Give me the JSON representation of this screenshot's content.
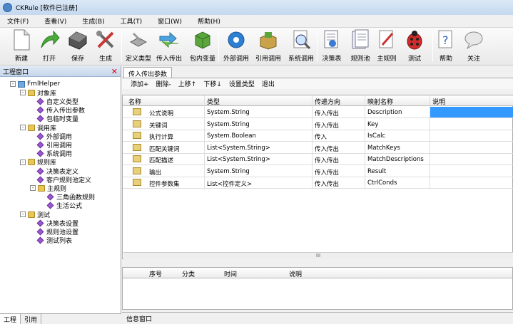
{
  "window": {
    "title": "CKRule [软件已注册]"
  },
  "menu": [
    "文件(F)",
    "查看(V)",
    "生成(B)",
    "工具(T)",
    "窗口(W)",
    "帮助(H)"
  ],
  "toolbar": {
    "new": "新建",
    "open": "打开",
    "save": "保存",
    "build": "生成",
    "define_type": "定义类型",
    "io": "传入传出",
    "pkg_var": "包内变量",
    "ext_call": "外部调用",
    "ref_call": "引用调用",
    "sys_call": "系统调用",
    "decision_table": "决策表",
    "rule_pool": "规则池",
    "main_rule": "主规则",
    "test": "测试",
    "help": "帮助",
    "about": "关注"
  },
  "left": {
    "title": "工程窗口",
    "tree": [
      {
        "label": "FmlHelper",
        "level": 0,
        "kind": "root",
        "toggle": "-"
      },
      {
        "label": "对象库",
        "level": 1,
        "kind": "folder",
        "toggle": "-"
      },
      {
        "label": "自定义类型",
        "level": 2,
        "kind": "item"
      },
      {
        "label": "传入传出参数",
        "level": 2,
        "kind": "item"
      },
      {
        "label": "包临时变量",
        "level": 2,
        "kind": "item"
      },
      {
        "label": "调用库",
        "level": 1,
        "kind": "folder",
        "toggle": "-"
      },
      {
        "label": "外部调用",
        "level": 2,
        "kind": "item"
      },
      {
        "label": "引用调用",
        "level": 2,
        "kind": "item"
      },
      {
        "label": "系统调用",
        "level": 2,
        "kind": "item"
      },
      {
        "label": "规则库",
        "level": 1,
        "kind": "folder",
        "toggle": "-"
      },
      {
        "label": "决策表定义",
        "level": 2,
        "kind": "item"
      },
      {
        "label": "客户规则池定义",
        "level": 2,
        "kind": "item"
      },
      {
        "label": "主规则",
        "level": 2,
        "kind": "folder",
        "toggle": "-"
      },
      {
        "label": "三角函数规则",
        "level": 3,
        "kind": "item"
      },
      {
        "label": "生活公式",
        "level": 3,
        "kind": "item"
      },
      {
        "label": "测试",
        "level": 1,
        "kind": "folder",
        "toggle": "-"
      },
      {
        "label": "决策表设置",
        "level": 2,
        "kind": "item"
      },
      {
        "label": "规则池设置",
        "level": 2,
        "kind": "item"
      },
      {
        "label": "测试列表",
        "level": 2,
        "kind": "item"
      }
    ],
    "tabs": [
      "工程",
      "引用"
    ]
  },
  "main": {
    "doc_tab": "传入传出参数",
    "actions": [
      "添加+",
      "删除-",
      "上移↑",
      "下移↓",
      "设置类型",
      "退出"
    ],
    "columns": [
      "名称",
      "类型",
      "传递方向",
      "映射名称",
      "说明"
    ],
    "rows": [
      {
        "name": "公式说明",
        "type": "System.String",
        "dir": "传入传出",
        "map": "Description",
        "desc": ""
      },
      {
        "name": "关键词",
        "type": "System.String",
        "dir": "传入传出",
        "map": "Key",
        "desc": ""
      },
      {
        "name": "执行计算",
        "type": "System.Boolean",
        "dir": "传入",
        "map": "IsCalc",
        "desc": ""
      },
      {
        "name": "匹配关键词",
        "type": "List<System.String>",
        "dir": "传入传出",
        "map": "MatchKeys",
        "desc": ""
      },
      {
        "name": "匹配描述",
        "type": "List<System.String>",
        "dir": "传入传出",
        "map": "MatchDescriptions",
        "desc": ""
      },
      {
        "name": "输出",
        "type": "System.String",
        "dir": "传入传出",
        "map": "Result",
        "desc": ""
      },
      {
        "name": "控件参数集",
        "type": "List<控件定义>",
        "dir": "传入传出",
        "map": "CtrlConds",
        "desc": ""
      }
    ],
    "scroll_grip": "III",
    "info_columns": [
      "序号",
      "分类",
      "时间",
      "说明"
    ],
    "info_tab": "信息窗口"
  },
  "colors": {
    "selection": "#3399ff",
    "title_bg": "#c4d8ef"
  }
}
